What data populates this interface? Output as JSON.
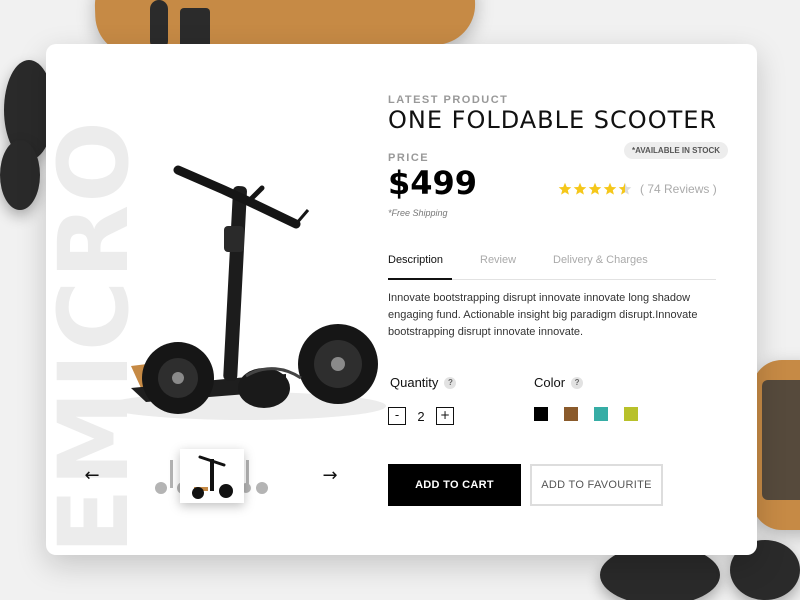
{
  "brand": {
    "watermark": "EMICRO"
  },
  "product": {
    "eyebrow": "LATEST PRODUCT",
    "title": "ONE FOLDABLE SCOOTER",
    "stock_badge": "*AVAILABLE IN STOCK",
    "price_label": "PRICE",
    "price": "$499",
    "shipping_note": "*Free Shipping",
    "rating": {
      "value": 4.5,
      "max": 5,
      "reviews_text": "( 74 Reviews )",
      "star_color": "#f5c71a"
    }
  },
  "tabs": [
    {
      "label": "Description",
      "active": true
    },
    {
      "label": "Review",
      "active": false
    },
    {
      "label": "Delivery & Charges",
      "active": false
    }
  ],
  "description": "Innovate bootstrapping disrupt innovate innovate long shadow engaging fund. Actionable insight big paradigm disrupt.Innovate bootstrapping disrupt innovate innovate.",
  "quantity": {
    "label": "Quantity",
    "value": "2",
    "minus": "-",
    "plus": "+",
    "help": "?"
  },
  "color": {
    "label": "Color",
    "help": "?",
    "options": [
      "#000000",
      "#8a5a2b",
      "#36ada5",
      "#b8c12a"
    ]
  },
  "gallery": {
    "prev_icon": "←",
    "next_icon": "→"
  },
  "actions": {
    "add_to_cart": "ADD TO CART",
    "add_to_favourite": "ADD TO FAVOURITE"
  },
  "colors": {
    "accent": "#000000",
    "deck_wood": "#c68a45"
  }
}
